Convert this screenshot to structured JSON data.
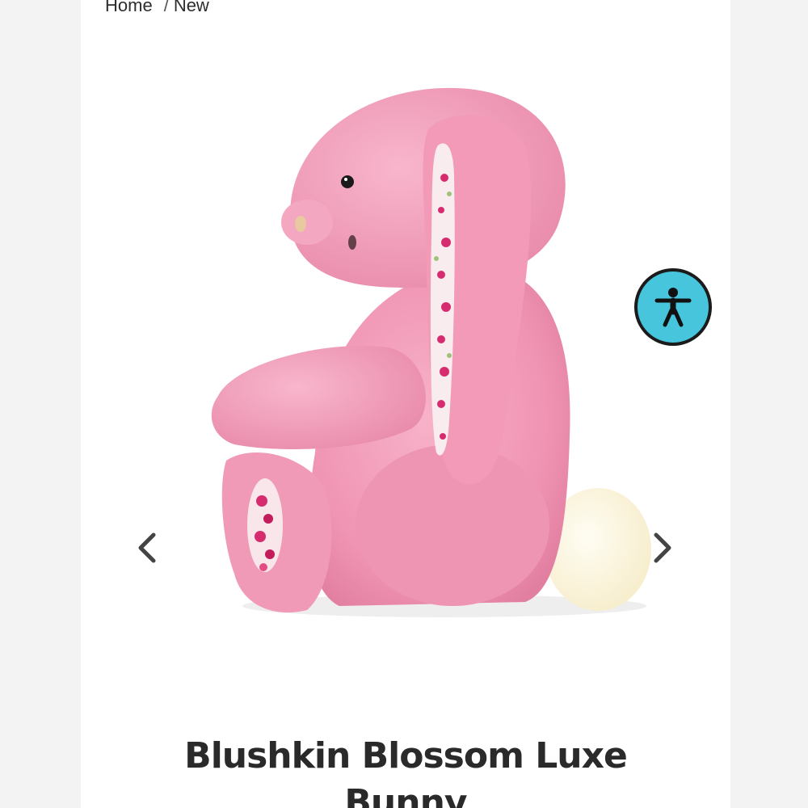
{
  "breadcrumb": {
    "home": "Home",
    "separator": "/",
    "current": "New"
  },
  "gallery": {
    "product_image_alt": "Blushkin Blossom Luxe Bunny",
    "prev_icon": "chevron-left-icon",
    "next_icon": "chevron-right-icon"
  },
  "accessibility": {
    "icon": "accessibility-person-icon",
    "color": "#46c5dc"
  },
  "product": {
    "title": "Blushkin Blossom Luxe Bunny"
  },
  "colors": {
    "bunny_pink": "#f29ab8",
    "tail_cream": "#fbf3dc",
    "text": "#2a2a2a"
  }
}
